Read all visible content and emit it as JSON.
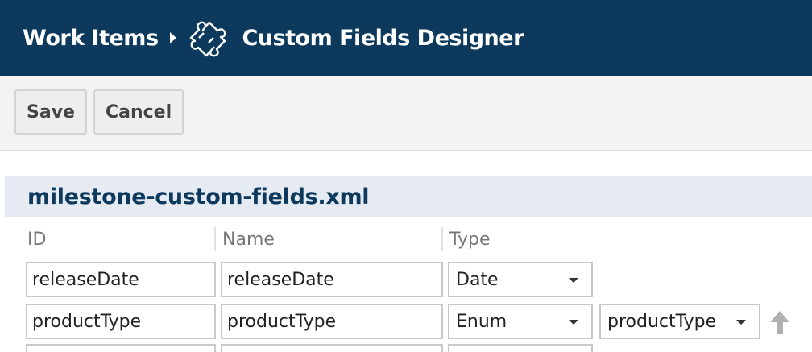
{
  "header": {
    "root_label": "Work Items",
    "current_label": "Custom Fields Designer",
    "background_color": "#0d3a5c"
  },
  "toolbar": {
    "save_label": "Save",
    "cancel_label": "Cancel"
  },
  "section": {
    "title": "milestone-custom-fields.xml"
  },
  "table": {
    "columns": [
      "ID",
      "Name",
      "Type"
    ],
    "rows": [
      {
        "id": "releaseDate",
        "name": "releaseDate",
        "type": "Date"
      },
      {
        "id": "productType",
        "name": "productType",
        "type": "Enum",
        "enum_ref": "productType"
      }
    ]
  },
  "icons": {
    "breadcrumb_separator": "chevron-right-icon",
    "page_icon": "puzzle-icon",
    "move_up": "arrow-up-icon",
    "dropdown": "caret-down-icon"
  }
}
